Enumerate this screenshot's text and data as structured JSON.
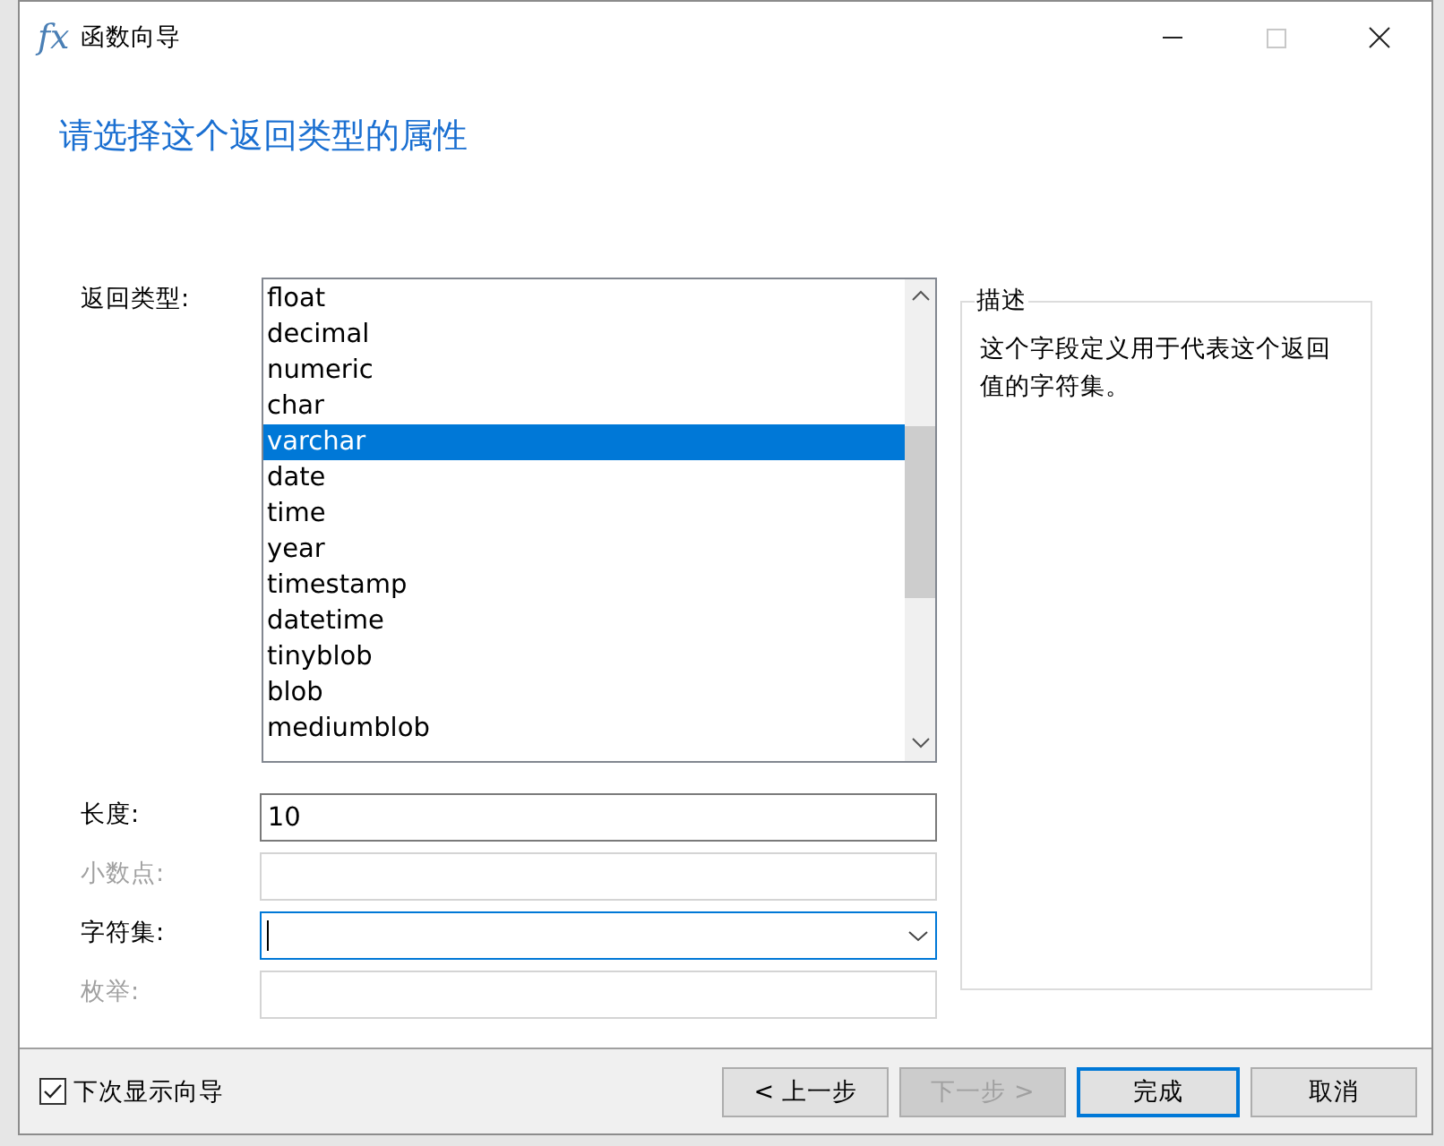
{
  "window": {
    "icon": "fx",
    "title": "函数向导",
    "controls": [
      {
        "kind": "minimize",
        "disabled": false
      },
      {
        "kind": "maximize",
        "disabled": true
      },
      {
        "kind": "close",
        "disabled": false
      }
    ]
  },
  "heading": "请选择这个返回类型的属性",
  "return_type": {
    "label": "返回类型:",
    "items": [
      {
        "label": "float",
        "selected": false
      },
      {
        "label": "decimal",
        "selected": false
      },
      {
        "label": "numeric",
        "selected": false
      },
      {
        "label": "char",
        "selected": false
      },
      {
        "label": "varchar",
        "selected": true
      },
      {
        "label": "date",
        "selected": false
      },
      {
        "label": "time",
        "selected": false
      },
      {
        "label": "year",
        "selected": false
      },
      {
        "label": "timestamp",
        "selected": false
      },
      {
        "label": "datetime",
        "selected": false
      },
      {
        "label": "tinyblob",
        "selected": false
      },
      {
        "label": "blob",
        "selected": false
      },
      {
        "label": "mediumblob",
        "selected": false
      }
    ]
  },
  "fields": [
    {
      "kind": "text",
      "label": "长度:",
      "value": "10",
      "disabled": false,
      "focused": false
    },
    {
      "kind": "text",
      "label": "小数点:",
      "disabled": true,
      "focused": false
    },
    {
      "kind": "combo",
      "label": "字符集:",
      "disabled": false,
      "focused": true
    },
    {
      "kind": "text",
      "label": "枚举:",
      "disabled": true,
      "focused": false
    }
  ],
  "description": {
    "title": "描述",
    "text": "这个字段定义用于代表这个返回值的字符集。"
  },
  "show_wizard_next": {
    "label": "下次显示向导",
    "checked": true
  },
  "buttons": [
    {
      "label": "< 上一步",
      "disabled": false,
      "default": false
    },
    {
      "label": "下一步 >",
      "disabled": true,
      "default": false
    },
    {
      "label": "完成",
      "disabled": false,
      "default": true
    },
    {
      "label": "取消",
      "disabled": false,
      "default": false
    }
  ]
}
